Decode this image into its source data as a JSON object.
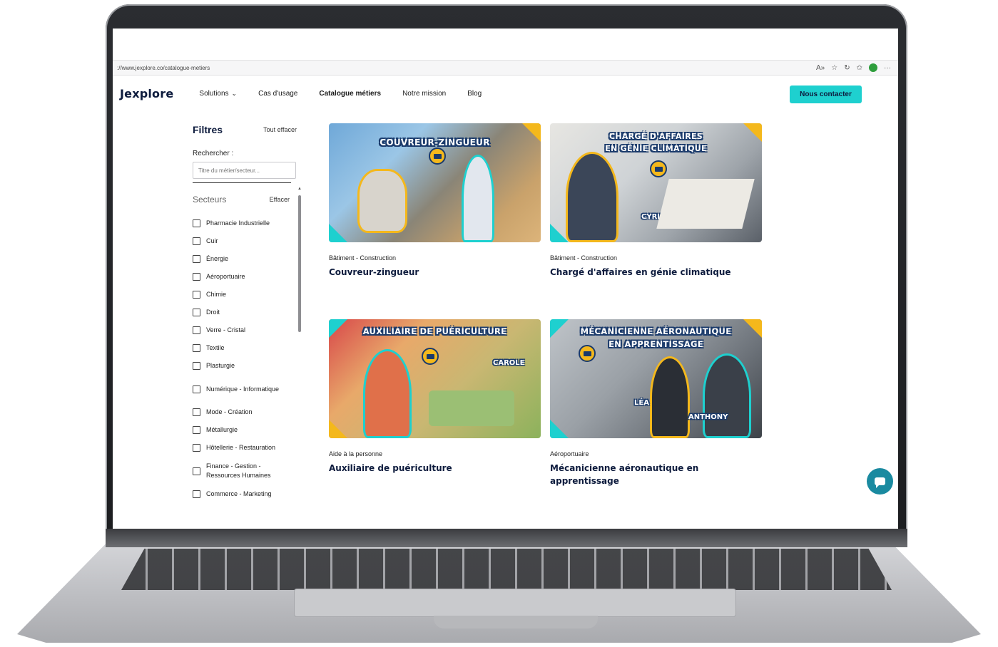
{
  "browser": {
    "url": "://www.jexplore.co/catalogue-metiers",
    "icons": [
      "read-aloud-icon",
      "favorite-icon",
      "refresh-icon",
      "collections-icon",
      "profile-icon",
      "more-icon"
    ]
  },
  "nav": {
    "logo": "Jexplore",
    "links": [
      {
        "label": "Solutions",
        "has_dropdown": true
      },
      {
        "label": "Cas d'usage"
      },
      {
        "label": "Catalogue métiers",
        "active": true
      },
      {
        "label": "Notre mission"
      },
      {
        "label": "Blog"
      }
    ],
    "cta": "Nous contacter",
    "accent_color": "#1ed0cf"
  },
  "filters": {
    "title": "Filtres",
    "clear_all": "Tout effacer",
    "search_label": "Rechercher :",
    "search_placeholder": "Titre du métier/secteur...",
    "sectors_title": "Secteurs",
    "sectors_clear": "Effacer",
    "sectors": [
      "Pharmacie Industrielle",
      "Cuir",
      "Énergie",
      "Aéroportuaire",
      "Chimie",
      "Droit",
      "Verre - Cristal",
      "Textile",
      "Plasturgie",
      "Numérique - Informatique",
      "Mode - Création",
      "Métallurgie",
      "Hôtellerie - Restauration",
      "Finance - Gestion - Ressources Humaines",
      "Commerce - Marketing"
    ]
  },
  "cards": [
    {
      "banner_lines": [
        "COUVREUR-ZINGUEUR"
      ],
      "name_tag": "",
      "category": "Bâtiment - Construction",
      "title": "Couvreur-zingueur"
    },
    {
      "banner_lines": [
        "CHARGÉ D'AFFAIRES",
        "EN GÉNIE CLIMATIQUE"
      ],
      "name_tag": "CYRIL",
      "category": "Bâtiment - Construction",
      "title": "Chargé d'affaires en génie climatique"
    },
    {
      "banner_lines": [
        "AUXILIAIRE DE PUÉRICULTURE"
      ],
      "name_tag": "CAROLE",
      "category": "Aide à la personne",
      "title": "Auxiliaire de puériculture"
    },
    {
      "banner_lines": [
        "MÉCANICIENNE AÉRONAUTIQUE",
        "EN APPRENTISSAGE"
      ],
      "name_tags": [
        "LÉA",
        "ANTHONY"
      ],
      "category": "Aéroportuaire",
      "title": "Mécanicienne aéronautique en apprentissage"
    }
  ]
}
